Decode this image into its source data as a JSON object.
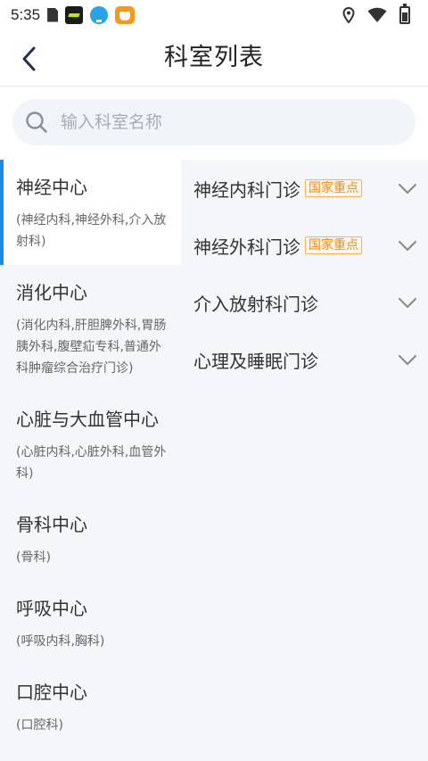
{
  "status_bar": {
    "time": "5:35",
    "left_icons": [
      "document-icon",
      "app-icon",
      "download-icon",
      "app-store-icon"
    ],
    "right_icons": [
      "location-icon",
      "wifi-icon",
      "battery-icon"
    ]
  },
  "header": {
    "title": "科室列表",
    "back_icon": "chevron-left-icon"
  },
  "search": {
    "placeholder": "输入科室名称",
    "value": "",
    "icon": "search-icon"
  },
  "centers": [
    {
      "name": "神经中心",
      "sub": "(神经内科,神经外科,介入放射科)",
      "active": true
    },
    {
      "name": "消化中心",
      "sub": "(消化内科,肝胆脾外科,胃肠胰外科,腹壁疝专科,普通外科肿瘤综合治疗门诊)",
      "active": false
    },
    {
      "name": "心脏与大血管中心",
      "sub": "(心脏内科,心脏外科,血管外科)",
      "active": false
    },
    {
      "name": "骨科中心",
      "sub": "(骨科)",
      "active": false
    },
    {
      "name": "呼吸中心",
      "sub": "(呼吸内科,胸科)",
      "active": false
    },
    {
      "name": "口腔中心",
      "sub": "(口腔科)",
      "active": false
    }
  ],
  "clinics": [
    {
      "name": "神经内科门诊",
      "tag": "国家重点"
    },
    {
      "name": "神经外科门诊",
      "tag": "国家重点"
    },
    {
      "name": "介入放射科门诊",
      "tag": ""
    },
    {
      "name": "心理及睡眠门诊",
      "tag": ""
    }
  ],
  "colors": {
    "accent": "#1e88e5",
    "tag_text": "#f08c18",
    "background": "#f4f6f9"
  }
}
